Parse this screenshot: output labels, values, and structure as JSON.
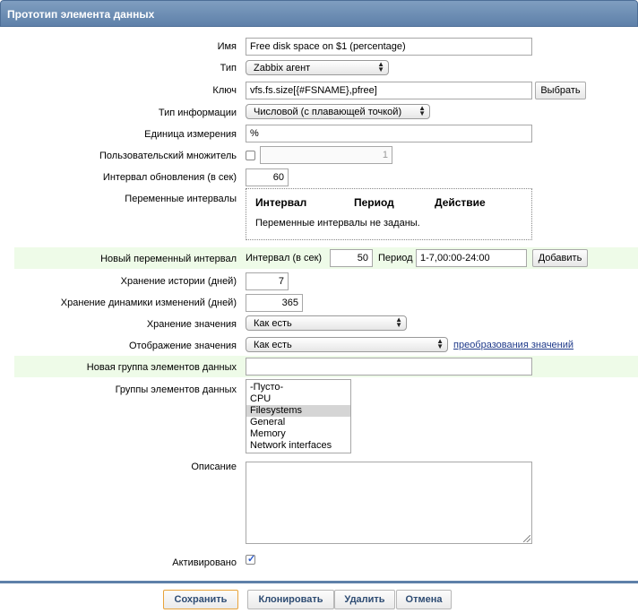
{
  "window": {
    "title": "Прототип элемента данных"
  },
  "form": {
    "name": {
      "label": "Имя",
      "value": "Free disk space on $1 (percentage)"
    },
    "type": {
      "label": "Тип",
      "value": "Zabbix агент"
    },
    "key": {
      "label": "Ключ",
      "value": "vfs.fs.size[{#FSNAME},pfree]",
      "button": "Выбрать"
    },
    "info_type": {
      "label": "Тип информации",
      "value": "Числовой (с плавающей точкой)"
    },
    "units": {
      "label": "Единица измерения",
      "value": "%"
    },
    "multiplier": {
      "label": "Пользовательский множитель",
      "value": "1",
      "checked": false
    },
    "interval": {
      "label": "Интервал обновления (в сек)",
      "value": "60"
    },
    "flex": {
      "label": "Переменные интервалы",
      "col_interval": "Интервал",
      "col_period": "Период",
      "col_action": "Действие",
      "empty": "Переменные интервалы не заданы."
    },
    "new_flex": {
      "label": "Новый переменный интервал",
      "interval_label": "Интервал (в сек)",
      "interval_value": "50",
      "period_label": "Период",
      "period_value": "1-7,00:00-24:00",
      "add_button": "Добавить"
    },
    "history": {
      "label": "Хранение истории (дней)",
      "value": "7"
    },
    "trends": {
      "label": "Хранение динамики изменений (дней)",
      "value": "365"
    },
    "store_value": {
      "label": "Хранение значения",
      "value": "Как есть"
    },
    "show_value": {
      "label": "Отображение значения",
      "value": "Как есть",
      "link": "преобразования значений"
    },
    "new_app": {
      "label": "Новая группа элементов данных",
      "value": ""
    },
    "apps": {
      "label": "Группы элементов данных",
      "items": [
        "-Пусто-",
        "CPU",
        "Filesystems",
        "General",
        "Memory",
        "Network interfaces"
      ],
      "selected": "Filesystems"
    },
    "description": {
      "label": "Описание",
      "value": ""
    },
    "enabled": {
      "label": "Активировано",
      "checked": true
    }
  },
  "footer": {
    "save": "Сохранить",
    "clone": "Клонировать",
    "delete": "Удалить",
    "cancel": "Отмена"
  }
}
